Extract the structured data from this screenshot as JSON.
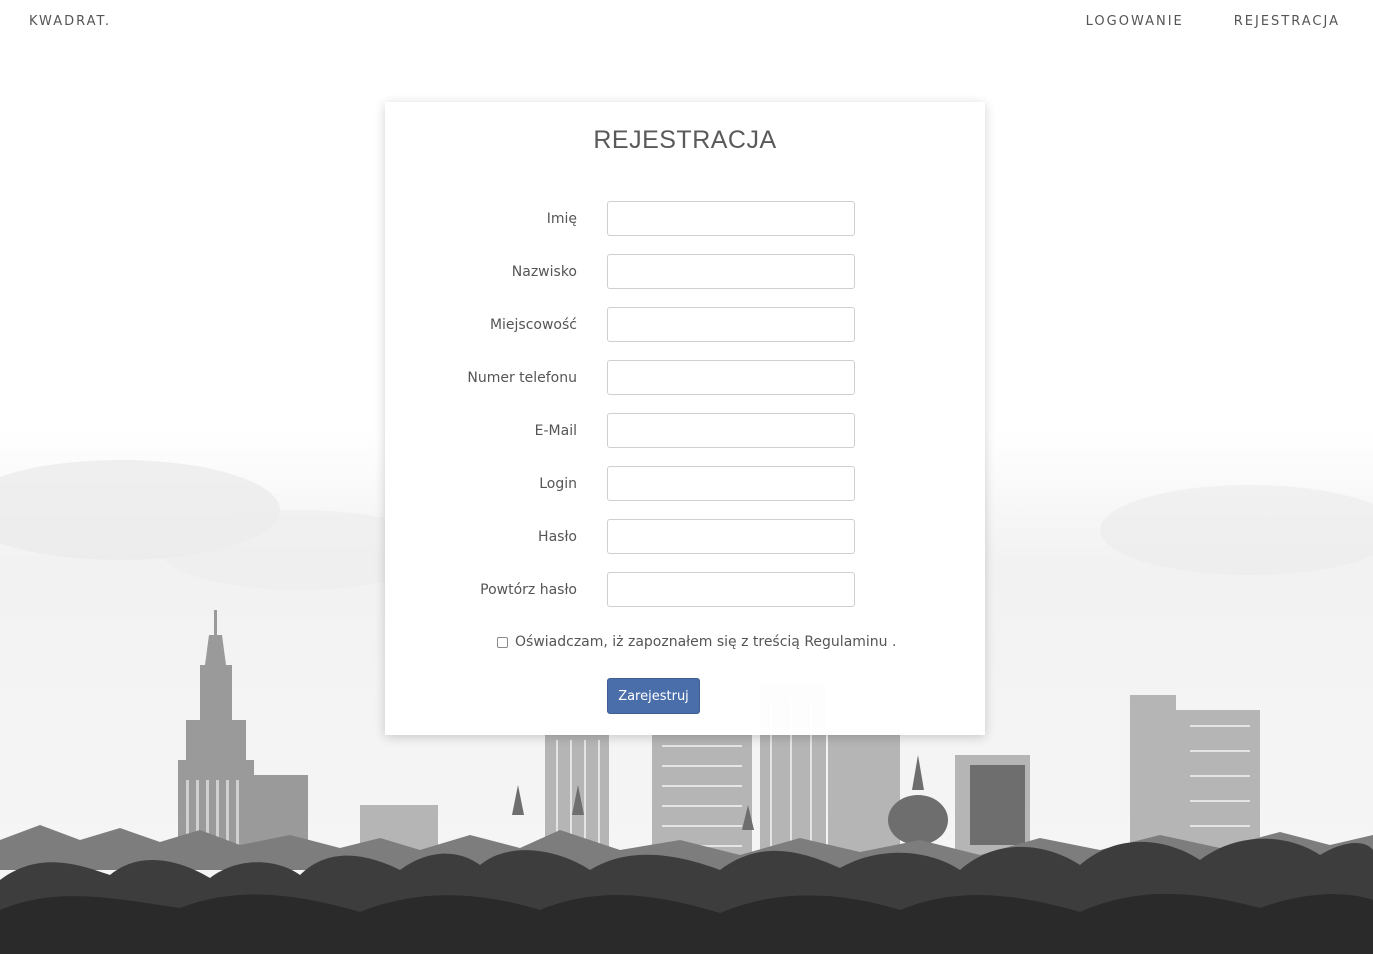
{
  "navbar": {
    "brand": "KWADRAT.",
    "links": [
      "LOGOWANIE",
      "REJESTRACJA"
    ]
  },
  "form": {
    "title": "REJESTRACJA",
    "fields": [
      {
        "label": "Imię",
        "value": ""
      },
      {
        "label": "Nazwisko",
        "value": ""
      },
      {
        "label": "Miejscowość",
        "value": ""
      },
      {
        "label": "Numer telefonu",
        "value": ""
      },
      {
        "label": "E-Mail",
        "value": ""
      },
      {
        "label": "Login",
        "value": ""
      },
      {
        "label": "Hasło",
        "value": ""
      },
      {
        "label": "Powtórz hasło",
        "value": ""
      }
    ],
    "terms_text": "Oświadczam, iż zapoznałem się z treścią Regulaminu .",
    "terms_checked": false,
    "submit_label": "Zarejestruj"
  },
  "colors": {
    "accent": "#4a6ea9",
    "text": "#555555"
  }
}
